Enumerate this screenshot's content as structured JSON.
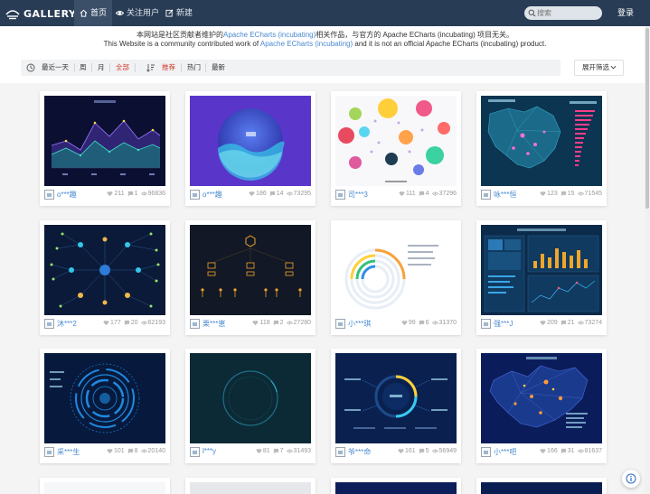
{
  "nav": {
    "logo_text": "GALLERY",
    "items": [
      {
        "label": "首页",
        "icon": "home-icon",
        "active": true
      },
      {
        "label": "关注用户",
        "icon": "eye-icon",
        "active": false
      },
      {
        "label": "新建",
        "icon": "edit-icon",
        "active": false
      }
    ],
    "search_placeholder": "搜索",
    "login_label": "登录"
  },
  "banner": {
    "line1_pre": "本网站是社区贡献者维护的",
    "line1_link": "Apache ECharts (incubating)",
    "line1_post": "相关作品，与官方的 Apache ECharts (incubating) 项目无关。",
    "line2_pre": "This Website is a community contributed work of ",
    "line2_link": "Apache ECharts (incubating)",
    "line2_post": " and it is not an official Apache ECharts (incubating) product."
  },
  "filters": {
    "time": [
      "最近一天",
      "周",
      "月",
      "全部"
    ],
    "time_active": "全部",
    "sort": [
      "推荐",
      "热门",
      "最新"
    ],
    "sort_active": "推荐",
    "expand_label": "展开筛选"
  },
  "cards": [
    {
      "author": "o***趣",
      "likes": "211",
      "comments": "1",
      "views": "96836",
      "thumb": "line-chart"
    },
    {
      "author": "o***趣",
      "likes": "186",
      "comments": "14",
      "views": "73295",
      "thumb": "liquid-fill"
    },
    {
      "author": "司***3",
      "likes": "111",
      "comments": "4",
      "views": "37296",
      "thumb": "bubble"
    },
    {
      "author": "咏***恒",
      "likes": "123",
      "comments": "15",
      "views": "71545",
      "thumb": "map-bar"
    },
    {
      "author": "沐***2",
      "likes": "177",
      "comments": "20",
      "views": "62193",
      "thumb": "graph-network"
    },
    {
      "author": "栗***崽",
      "likes": "118",
      "comments": "2",
      "views": "27280",
      "thumb": "tree-icons"
    },
    {
      "author": "小***琪",
      "likes": "99",
      "comments": "6",
      "views": "31370",
      "thumb": "ring-progress"
    },
    {
      "author": "强***J",
      "likes": "209",
      "comments": "21",
      "views": "73274",
      "thumb": "dashboard"
    },
    {
      "author": "采***生",
      "likes": "101",
      "comments": "8",
      "views": "20140",
      "thumb": "radial-circles"
    },
    {
      "author": "l***y",
      "likes": "81",
      "comments": "7",
      "views": "31493",
      "thumb": "dark-ring"
    },
    {
      "author": "爷***命",
      "likes": "161",
      "comments": "5",
      "views": "56949",
      "thumb": "gauge-ring"
    },
    {
      "author": "小***吧",
      "likes": "166",
      "comments": "31",
      "views": "81637",
      "thumb": "province-map"
    }
  ],
  "colors": {
    "nav_bg": "#293c55",
    "accent_red": "#d23c2e",
    "link_blue": "#4a8ad0"
  }
}
